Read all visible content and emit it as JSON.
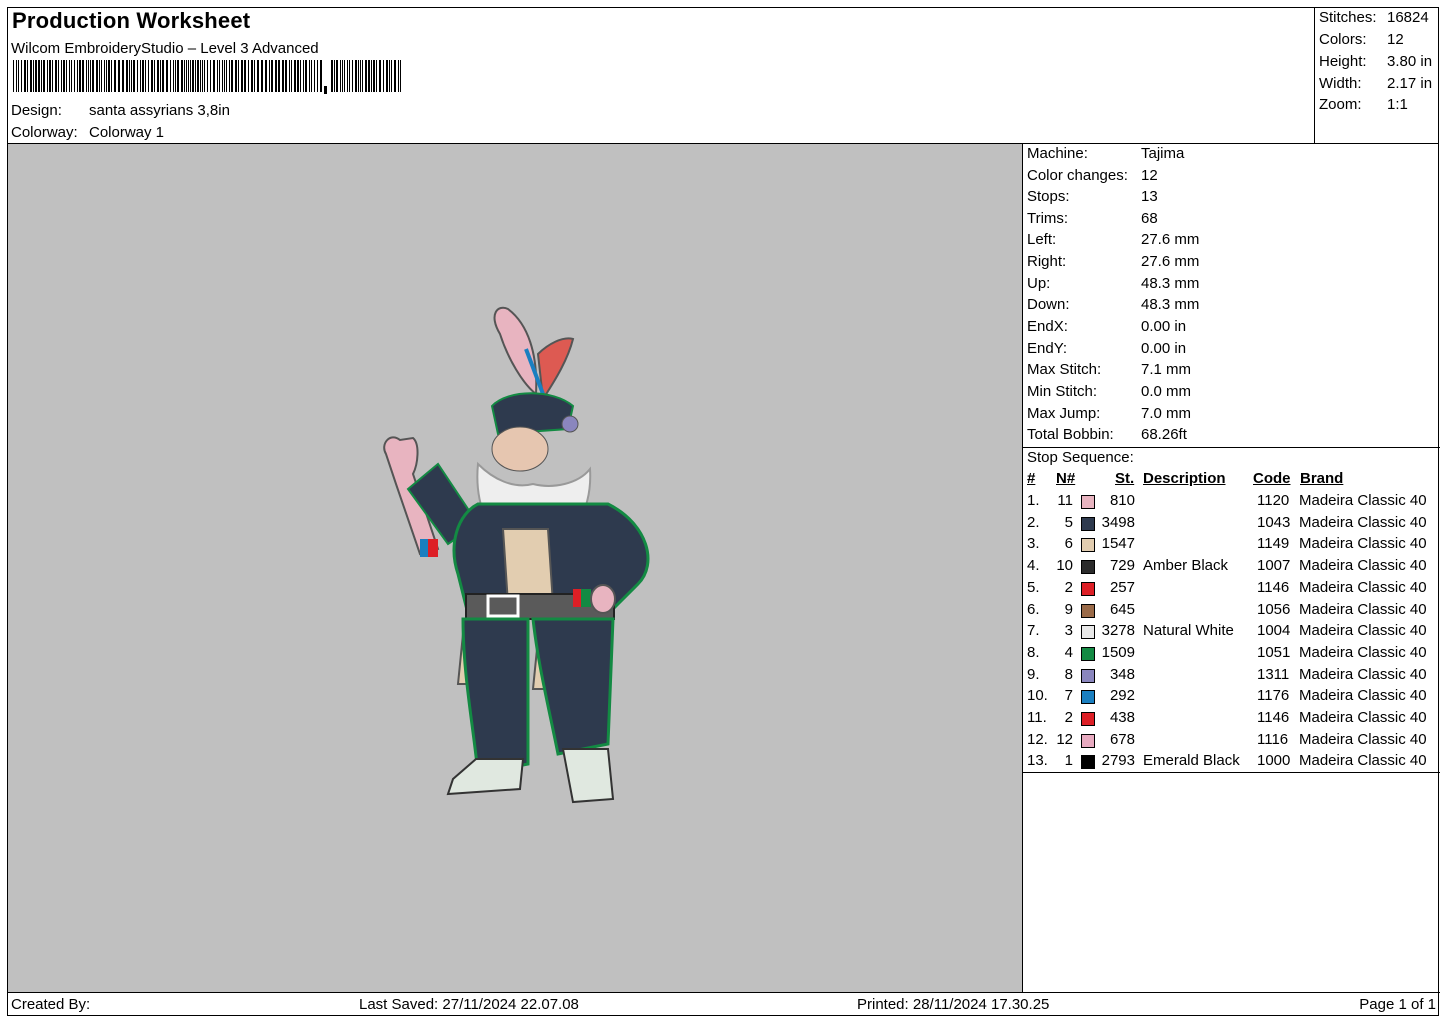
{
  "header": {
    "title": "Production Worksheet",
    "software": "Wilcom EmbroideryStudio – Level 3 Advanced",
    "design_label": "Design:",
    "design_value": "santa assyrians 3,8in",
    "colorway_label": "Colorway:",
    "colorway_value": "Colorway 1"
  },
  "stats": [
    {
      "label": "Stitches:",
      "value": "16824"
    },
    {
      "label": "Colors:",
      "value": "12"
    },
    {
      "label": "Height:",
      "value": "3.80 in"
    },
    {
      "label": "Width:",
      "value": "2.17 in"
    },
    {
      "label": "Zoom:",
      "value": "1:1"
    }
  ],
  "machine_info": [
    {
      "label": "Machine:",
      "value": "Tajima"
    },
    {
      "label": "Color changes:",
      "value": "12"
    },
    {
      "label": "Stops:",
      "value": "13"
    },
    {
      "label": "Trims:",
      "value": "68"
    },
    {
      "label": "Left:",
      "value": "27.6 mm"
    },
    {
      "label": "Right:",
      "value": "27.6 mm"
    },
    {
      "label": "Up:",
      "value": "48.3 mm"
    },
    {
      "label": "Down:",
      "value": "48.3 mm"
    },
    {
      "label": "EndX:",
      "value": "0.00 in"
    },
    {
      "label": "EndY:",
      "value": "0.00 in"
    },
    {
      "label": "Max Stitch:",
      "value": "7.1 mm"
    },
    {
      "label": "Min Stitch:",
      "value": "0.0 mm"
    },
    {
      "label": "Max Jump:",
      "value": "7.0 mm"
    },
    {
      "label": "Total Bobbin:",
      "value": "68.26ft"
    }
  ],
  "stop_sequence": {
    "title": "Stop Sequence:",
    "headers": {
      "num": "#",
      "n": "N#",
      "st": "St.",
      "desc": "Description",
      "code": "Code",
      "brand": "Brand"
    },
    "rows": [
      {
        "num": "1.",
        "n": "11",
        "color": "#e8b4c0",
        "st": "810",
        "desc": "",
        "code": "1120",
        "brand": "Madeira Classic 40"
      },
      {
        "num": "2.",
        "n": "5",
        "color": "#2e3a4e",
        "st": "3498",
        "desc": "",
        "code": "1043",
        "brand": "Madeira Classic 40"
      },
      {
        "num": "3.",
        "n": "6",
        "color": "#e2cdb0",
        "st": "1547",
        "desc": "",
        "code": "1149",
        "brand": "Madeira Classic 40"
      },
      {
        "num": "4.",
        "n": "10",
        "color": "#2b2b2b",
        "st": "729",
        "desc": "Amber Black",
        "code": "1007",
        "brand": "Madeira Classic 40"
      },
      {
        "num": "5.",
        "n": "2",
        "color": "#dd1f26",
        "st": "257",
        "desc": "",
        "code": "1146",
        "brand": "Madeira Classic 40"
      },
      {
        "num": "6.",
        "n": "9",
        "color": "#9a6a48",
        "st": "645",
        "desc": "",
        "code": "1056",
        "brand": "Madeira Classic 40"
      },
      {
        "num": "7.",
        "n": "3",
        "color": "#e8e8e8",
        "st": "3278",
        "desc": "Natural White",
        "code": "1004",
        "brand": "Madeira Classic 40"
      },
      {
        "num": "8.",
        "n": "4",
        "color": "#138a43",
        "st": "1509",
        "desc": "",
        "code": "1051",
        "brand": "Madeira Classic 40"
      },
      {
        "num": "9.",
        "n": "8",
        "color": "#8a86be",
        "st": "348",
        "desc": "",
        "code": "1311",
        "brand": "Madeira Classic 40"
      },
      {
        "num": "10.",
        "n": "7",
        "color": "#1a7fc0",
        "st": "292",
        "desc": "",
        "code": "1176",
        "brand": "Madeira Classic 40"
      },
      {
        "num": "11.",
        "n": "2",
        "color": "#dd1f26",
        "st": "438",
        "desc": "",
        "code": "1146",
        "brand": "Madeira Classic 40"
      },
      {
        "num": "12.",
        "n": "12",
        "color": "#e8aac0",
        "st": "678",
        "desc": "",
        "code": "1116",
        "brand": "Madeira Classic 40"
      },
      {
        "num": "13.",
        "n": "1",
        "color": "#000000",
        "st": "2793",
        "desc": "Emerald Black",
        "code": "1000",
        "brand": "Madeira Classic 40"
      }
    ]
  },
  "footer": {
    "created": "Created By:",
    "last_saved": "Last Saved: 27/11/2024 22.07.08",
    "printed": "Printed: 28/11/2024 17.30.25",
    "page": "Page 1 of 1"
  }
}
